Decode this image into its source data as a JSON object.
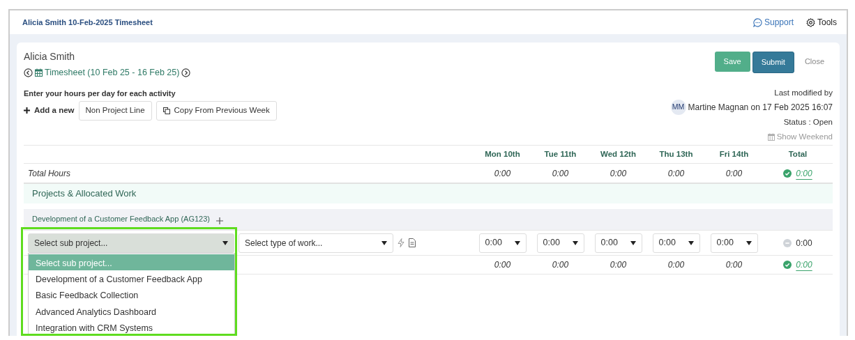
{
  "header": {
    "title": "Alicia Smith 10-Feb-2025 Timesheet",
    "links": [
      {
        "label": "Support",
        "kind": "support"
      },
      {
        "label": "Tools",
        "kind": "tools"
      }
    ]
  },
  "card": {
    "employee": "Alicia Smith",
    "period": "Timesheet (10 Feb 25 - 16 Feb 25)",
    "buttons": [
      {
        "label": "Save",
        "kind": "save"
      },
      {
        "label": "Submit",
        "kind": "submit"
      },
      {
        "label": "Close",
        "kind": "close"
      }
    ],
    "instructions": "Enter your hours per day for each activity",
    "add_label": "Add a new",
    "actions": [
      {
        "label": "Non Project Line",
        "kind": "plain"
      },
      {
        "label": "Copy From Previous Week",
        "kind": "copy"
      }
    ],
    "modified_label": "Last modified by",
    "modified_initials": "MM",
    "modified_text": "Martine Magnan on 17 Feb 2025 16:07",
    "status": "Status : Open",
    "show_weekend": "Show Weekend"
  },
  "table": {
    "columns": [
      "Mon 10th",
      "Tue 11th",
      "Wed 12th",
      "Thu 13th",
      "Fri 14th",
      "Total"
    ],
    "total_row": {
      "label": "Total Hours",
      "values": [
        "0:00",
        "0:00",
        "0:00",
        "0:00",
        "0:00"
      ],
      "total": "0:00",
      "complete": true
    },
    "section": "Projects & Allocated Work",
    "project": "Development of a Customer Feedback App (AG123)",
    "entry": {
      "sub_project": "Select sub project...",
      "work_type": "Select type of work...",
      "hours": [
        "0:00",
        "0:00",
        "0:00",
        "0:00",
        "0:00"
      ],
      "total": "0:00",
      "complete": false
    },
    "subtotal": {
      "values": [
        "0:00",
        "0:00",
        "0:00",
        "0:00",
        "0:00"
      ],
      "total": "0:00",
      "complete": true
    }
  },
  "dropdown": {
    "highlighted": true,
    "options": [
      {
        "label": "Select sub project...",
        "selected": true
      },
      {
        "label": "Development of a Customer Feedback App",
        "selected": false
      },
      {
        "label": "Basic Feedback Collection",
        "selected": false
      },
      {
        "label": "Advanced Analytics Dashboard",
        "selected": false
      },
      {
        "label": "Integration with CRM Systems",
        "selected": false
      }
    ]
  }
}
